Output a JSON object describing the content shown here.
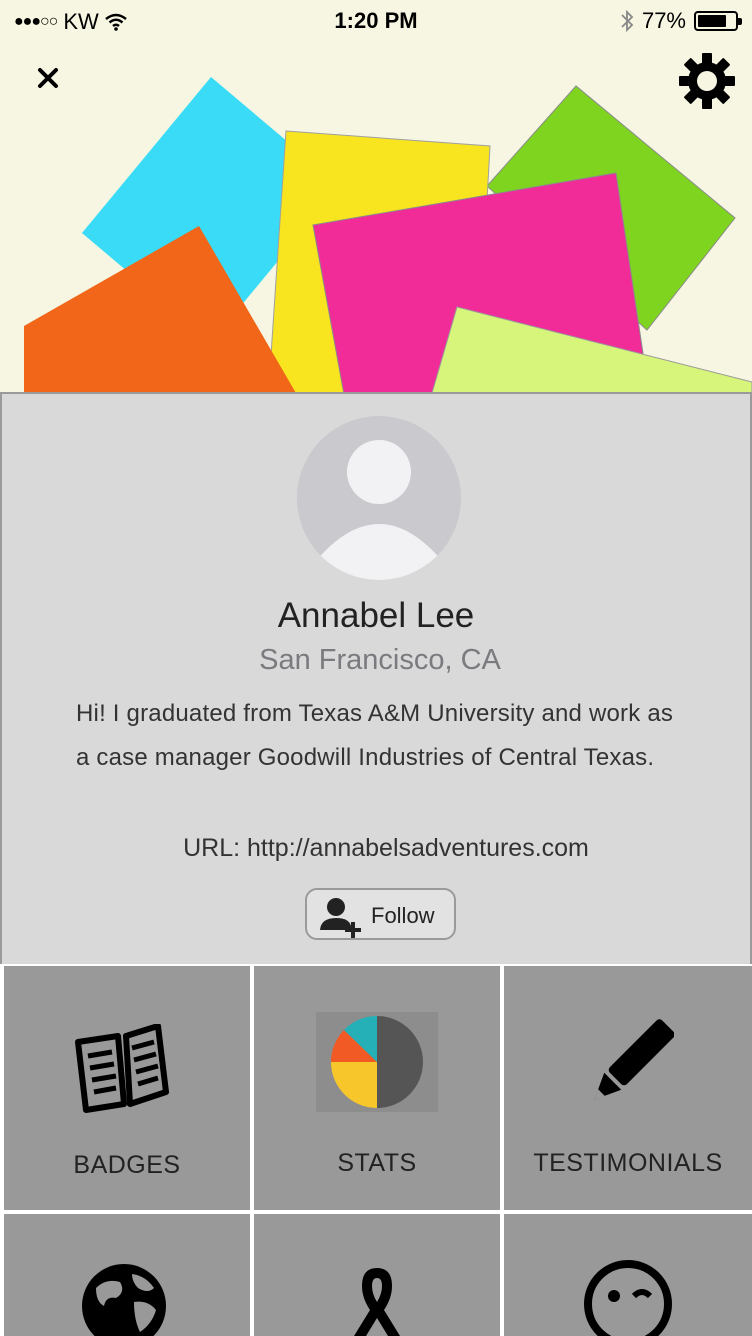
{
  "status_bar": {
    "signal": "●●●○○",
    "carrier": "KW",
    "time": "1:20 PM",
    "battery_percent": "77%",
    "battery_level": 0.77
  },
  "header": {
    "close_label": "×",
    "banner_colors": [
      "#39dbf6",
      "#f8e51f",
      "#7fd420",
      "#f12c99",
      "#f26619",
      "#d6f57a"
    ]
  },
  "profile": {
    "name": "Annabel Lee",
    "location": "San Francisco, CA",
    "bio": "Hi!  I  graduated from Texas A&M University and work as a case manager Goodwill Industries of Central Texas.",
    "url": "URL: http://annabelsadventures.com",
    "follow_label": "Follow"
  },
  "tiles": [
    {
      "label": "BADGES",
      "icon": "book-icon"
    },
    {
      "label": "STATS",
      "icon": "pie-chart-icon"
    },
    {
      "label": "TESTIMONIALS",
      "icon": "pencil-icon"
    },
    {
      "label": "",
      "icon": "globe-icon"
    },
    {
      "label": "",
      "icon": "ribbon-icon"
    },
    {
      "label": "",
      "icon": "wink-face-icon"
    }
  ],
  "colors": {
    "banner_bg": "#f6f6e2",
    "panel_bg": "#d9d9d9",
    "tile_bg": "#999999"
  }
}
